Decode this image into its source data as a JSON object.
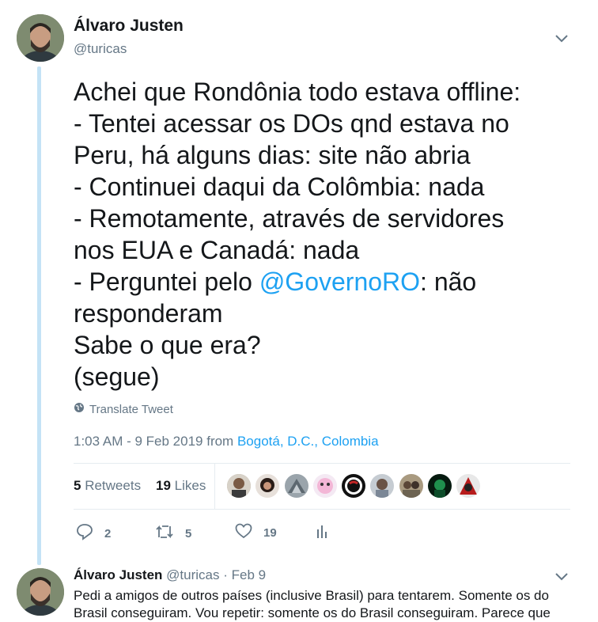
{
  "tweet": {
    "author_name": "Álvaro Justen",
    "author_handle": "@turicas",
    "text_lines": [
      "Achei que Rondônia todo estava offline:",
      "- Tentei acessar os DOs qnd estava no",
      "Peru, há alguns dias: site não abria",
      "- Continuei daqui da Colômbia: nada",
      "- Remotamente, através de servidores",
      "nos EUA e Canadá: nada",
      "- Perguntei pelo ",
      "@GovernoRO",
      ": não",
      "responderam",
      "Sabe o que era?",
      "(segue)"
    ],
    "translate_label": "Translate Tweet",
    "timestamp": "1:03 AM - 9 Feb 2019 from ",
    "location": "Bogotá, D.C., Colombia",
    "retweets_count": "5",
    "retweets_label": "Retweets",
    "likes_count": "19",
    "likes_label": "Likes",
    "actions": {
      "reply_count": "2",
      "retweet_count": "5",
      "like_count": "19"
    }
  },
  "reply": {
    "author_name": "Álvaro Justen",
    "author_handle": "@turicas",
    "date": "· Feb 9",
    "text_line1": "Pedi a amigos de outros países (inclusive Brasil) para tentarem. Somente os do",
    "text_line2": "Brasil conseguiram. Vou repetir: somente os do Brasil conseguiram. Parece que"
  },
  "colors": {
    "accent": "#1da1f2",
    "muted": "#657786",
    "thread_line": "#c4e3f6"
  },
  "icons": [
    "chevron-down-icon",
    "globe-icon",
    "reply-icon",
    "retweet-icon",
    "heart-icon",
    "analytics-icon"
  ]
}
